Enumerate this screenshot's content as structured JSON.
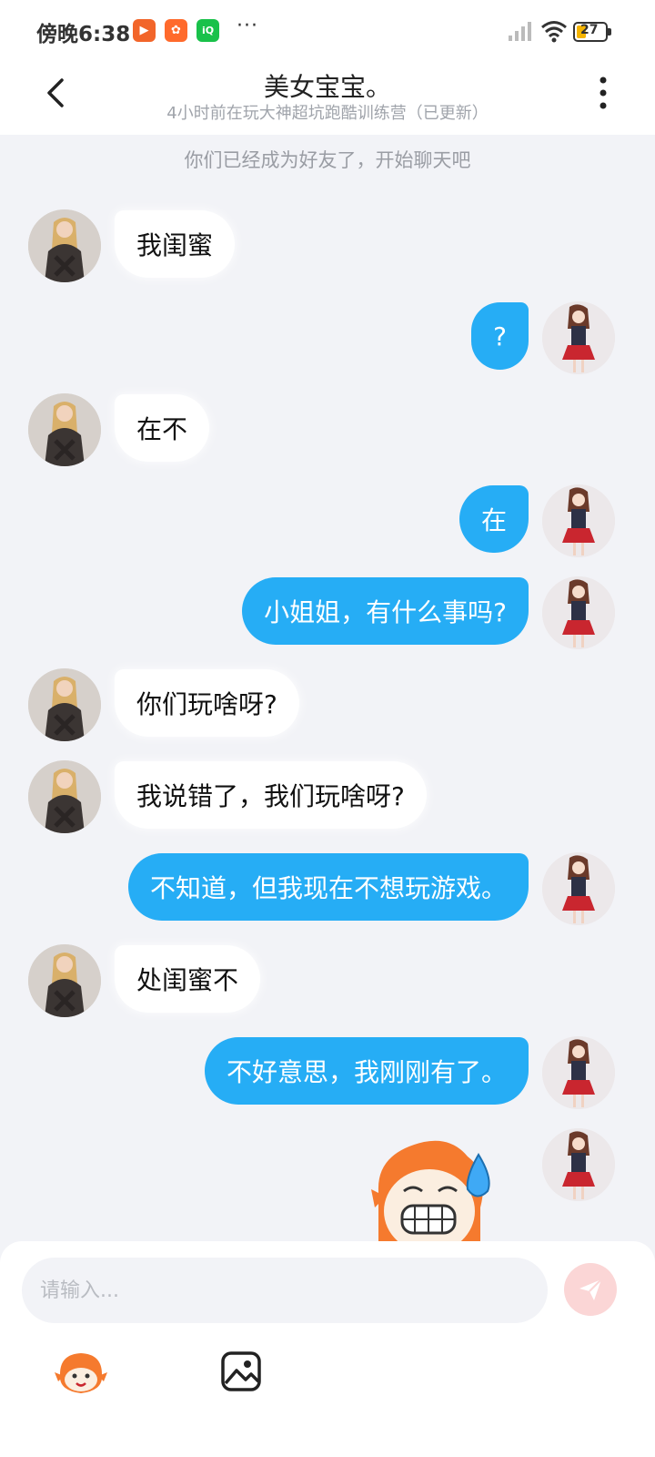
{
  "status_bar": {
    "time": "傍晚6:38",
    "battery": "27",
    "notification_apps": [
      {
        "name": "video-app-icon",
        "glyph": "▶",
        "color": "#f2652a"
      },
      {
        "name": "kuaishou-app-icon",
        "glyph": "✿",
        "color": "#ff6a2c"
      },
      {
        "name": "iqiyi-app-icon",
        "glyph": "iQ",
        "color": "#19c14a"
      }
    ],
    "more_dots": "···"
  },
  "header": {
    "title": "美女宝宝。",
    "subtitle": "4小时前在玩大神超坑跑酷训练营（已更新）"
  },
  "system_notice": "你们已经成为好友了，开始聊天吧",
  "messages": [
    {
      "side": "left",
      "text": "我闺蜜"
    },
    {
      "side": "right",
      "text": "?"
    },
    {
      "side": "left",
      "text": "在不"
    },
    {
      "side": "right",
      "text": "在"
    },
    {
      "side": "right",
      "text": "小姐姐，有什么事吗?"
    },
    {
      "side": "left",
      "text": "你们玩啥呀?"
    },
    {
      "side": "left",
      "text": "我说错了，我们玩啥呀?"
    },
    {
      "side": "right",
      "text": "不知道，但我现在不想玩游戏。"
    },
    {
      "side": "left",
      "text": "处闺蜜不"
    },
    {
      "side": "right",
      "text": "不好意思，我刚刚有了。"
    },
    {
      "side": "right",
      "type": "sticker",
      "sticker": "nervous-sweat-cartoon"
    }
  ],
  "input": {
    "placeholder": "请输入..."
  },
  "colors": {
    "accent": "#26adf5",
    "background": "#f2f3f7",
    "send_disabled": "#fbd6d6"
  }
}
